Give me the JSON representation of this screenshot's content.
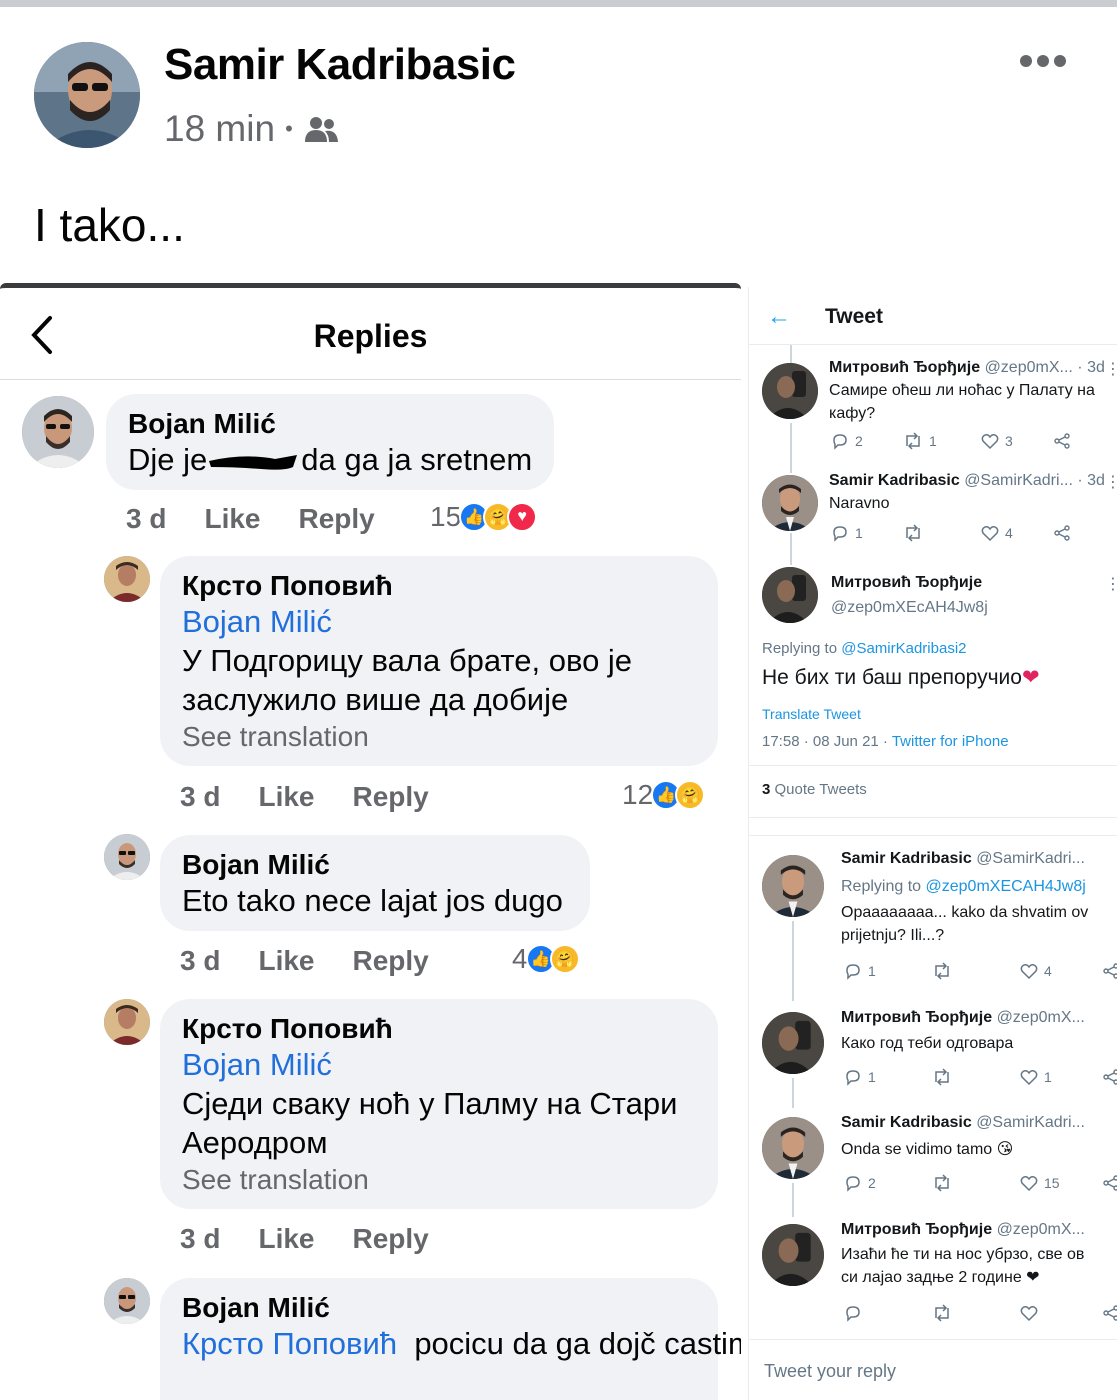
{
  "post": {
    "author": "Samir Kadribasic",
    "time": "18 min",
    "separator": "•",
    "audience_icon": "friends-icon",
    "text": "I tako..."
  },
  "fb_replies": {
    "title": "Replies",
    "comments": [
      {
        "name": "Bojan Milić",
        "text_before": "Dje je",
        "text_after": "da ga ja sretnem",
        "time": "3 d",
        "like": "Like",
        "reply": "Reply",
        "reactions": "15"
      },
      {
        "name": "Крсто Поповић",
        "mention": "Bojan Milić",
        "text": "У Подгорицу вала брате, ово је заслужило више да добије",
        "see_translation": "See translation",
        "time": "3 d",
        "like": "Like",
        "reply": "Reply",
        "reactions": "12"
      },
      {
        "name": "Bojan Milić",
        "text": "Eto tako nece lajat jos dugo",
        "time": "3 d",
        "like": "Like",
        "reply": "Reply",
        "reactions": "4"
      },
      {
        "name": "Крсто Поповић",
        "mention": "Bojan Milić",
        "text": "Сједи сваку ноћ у Палму на Стари Аеродром",
        "see_translation": "See translation",
        "time": "3 d",
        "like": "Like",
        "reply": "Reply"
      },
      {
        "name": "Bojan Milić",
        "mention": "Крсто Поповић",
        "text": "pocicu da ga dojč castim prvom prilikom"
      }
    ]
  },
  "twitter": {
    "title": "Tweet",
    "thread": [
      {
        "name": "Митровић Ђорђије",
        "handle": "@zep0mX...",
        "age": "· 3d",
        "text": [
          "Самире оћеш ли ноћас у Палату на",
          "кафу?"
        ],
        "replies": "2",
        "retweets": "1",
        "likes": "3"
      },
      {
        "name": "Samir Kadribasic",
        "handle": "@SamirKadri...",
        "age": "· 3d",
        "text": [
          "Naravno"
        ],
        "replies": "1",
        "retweets": "",
        "likes": "4"
      }
    ],
    "main": {
      "name": "Митровић Ђорђије",
      "handle": "@zep0mXEcAH4Jw8j",
      "replying_to_label": "Replying to",
      "replying_to": "@SamirKadribasi2",
      "text": "Не бих ти баш препоручио",
      "translate": "Translate Tweet",
      "time": "17:58 · 08 Jun 21 ·",
      "source": "Twitter for iPhone",
      "quote_count": "3",
      "quote_label": "Quote Tweets"
    },
    "replies": [
      {
        "name": "Samir Kadribasic",
        "handle": "@SamirKadri...",
        "replying_label": "Replying to",
        "replying_to": "@zep0mXECAH4Jw8j",
        "text": [
          "Opaaaaaaaa... kako da shvatim ov",
          "prijetnju? Ili...?"
        ],
        "replies": "1",
        "likes": "4"
      },
      {
        "name": "Митровић Ђорђије",
        "handle": "@zep0mX...",
        "text": [
          "Како год теби одговара"
        ],
        "replies": "1",
        "likes": "1"
      },
      {
        "name": "Samir Kadribasic",
        "handle": "@SamirKadri...",
        "text": [
          "Onda se vidimo tamo 😘"
        ],
        "replies": "2",
        "likes": "15"
      },
      {
        "name": "Митровић Ђорђије",
        "handle": "@zep0mX...",
        "text": [
          "Изаћи ће ти на нос убрзо, све ов",
          "си лајао задње 2 године ❤"
        ],
        "replies": "",
        "likes": ""
      }
    ],
    "reply_placeholder": "Tweet your reply"
  },
  "colors": {
    "fb_blue": "#1877f2",
    "mention_blue": "#216fdb",
    "twitter_blue": "#1da1f2",
    "heart_red": "#e0245e"
  }
}
